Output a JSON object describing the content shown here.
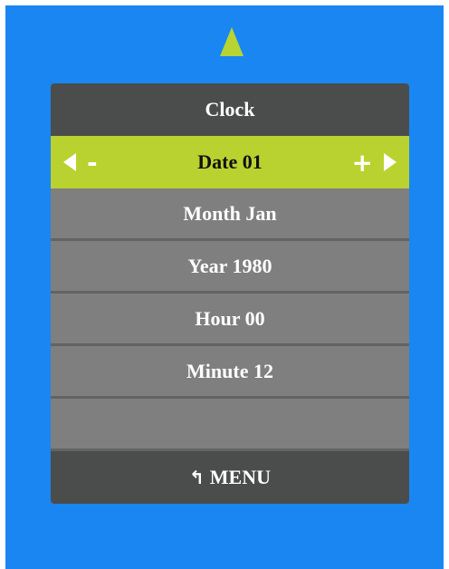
{
  "menu": {
    "title": "Clock",
    "selected": {
      "label": "Date 01",
      "minus": "-",
      "plus": "+"
    },
    "items": [
      "Month Jan",
      "Year 1980",
      "Hour 00",
      "Minute 12"
    ],
    "footer": {
      "icon": "back-arrow-icon",
      "label": "MENU"
    }
  },
  "colors": {
    "background": "#1a86f2",
    "accent": "#b9d22f",
    "panel": "#7f7f7f",
    "header": "#4a4d4c"
  }
}
